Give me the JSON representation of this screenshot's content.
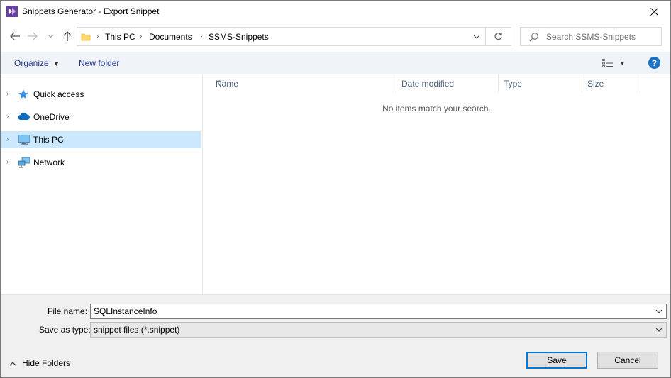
{
  "window": {
    "title": "Snippets Generator - Export Snippet",
    "close_glyph": "✕"
  },
  "nav": {
    "back_icon": "arrow-left-icon",
    "forward_icon": "arrow-right-icon",
    "recent_icon": "chevron-down-icon",
    "up_icon": "arrow-up-icon",
    "breadcrumb": [
      "This PC",
      "Documents",
      "SSMS-Snippets"
    ],
    "search_placeholder": "Search SSMS-Snippets"
  },
  "toolbar": {
    "organize_label": "Organize",
    "new_folder_label": "New folder",
    "help_label": "?"
  },
  "navpane": {
    "items": [
      {
        "label": "Quick access",
        "icon": "star-icon"
      },
      {
        "label": "OneDrive",
        "icon": "cloud-icon"
      },
      {
        "label": "This PC",
        "icon": "monitor-icon",
        "selected": true
      },
      {
        "label": "Network",
        "icon": "network-icon"
      }
    ]
  },
  "filelist": {
    "columns": [
      "Name",
      "Date modified",
      "Type",
      "Size"
    ],
    "empty_message": "No items match your search."
  },
  "bottom": {
    "file_name_label": "File name:",
    "file_name_value": "SQLInstanceInfo",
    "save_type_label": "Save as type:",
    "save_type_value": "snippet files (*.snippet)",
    "hide_folders_label": "Hide Folders",
    "save_label": "Save",
    "cancel_label": "Cancel"
  },
  "colors": {
    "accent": "#0078d7",
    "selection": "#cce8ff",
    "toolbar_bg": "#f0f4f9",
    "link_text": "#1e3287"
  }
}
